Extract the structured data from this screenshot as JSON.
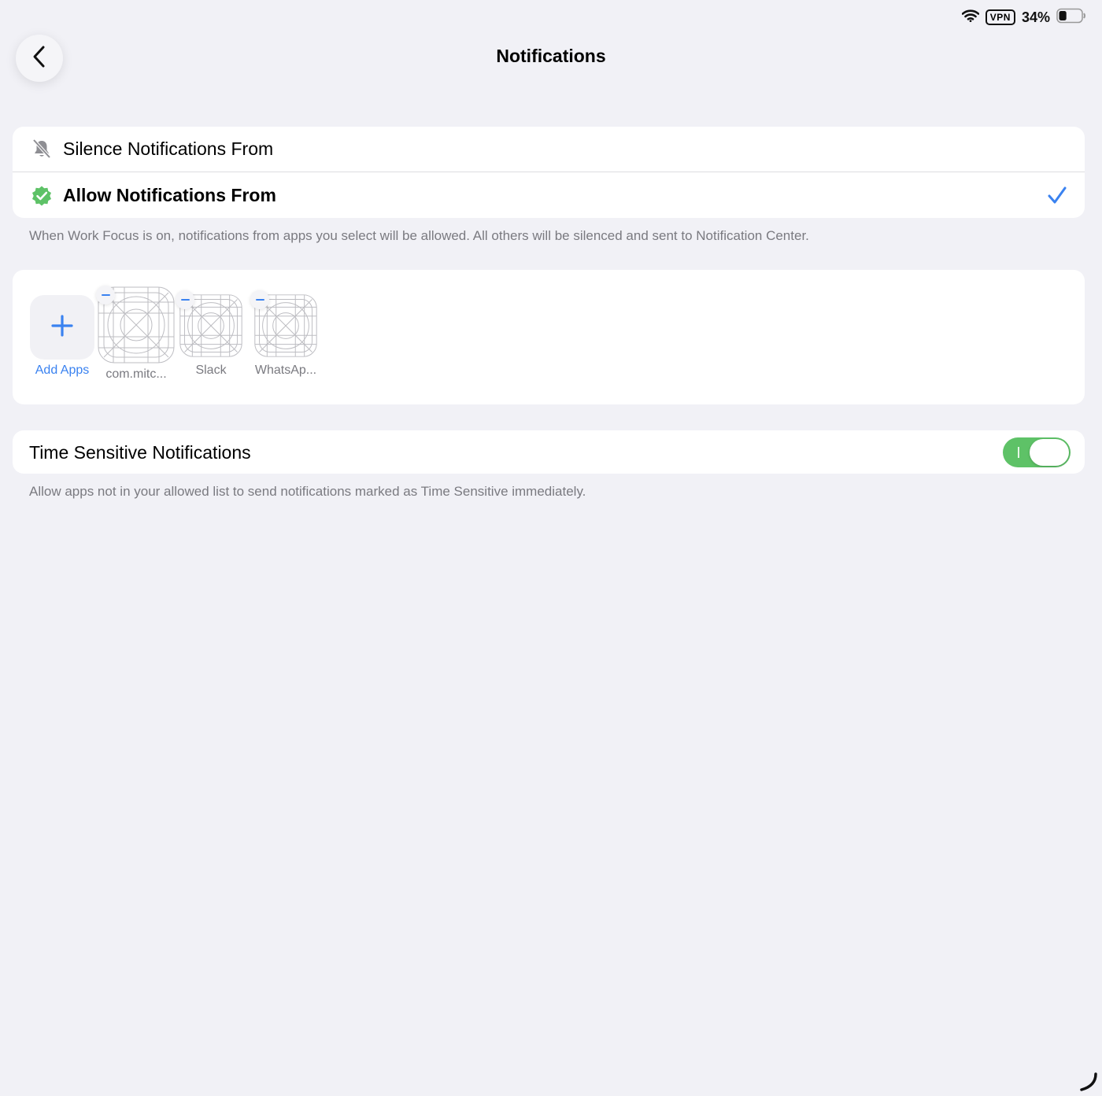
{
  "status_bar": {
    "wifi_icon": "wifi-icon",
    "vpn_label": "VPN",
    "battery_percent": "34%",
    "battery_level": 0.34
  },
  "header": {
    "back_icon": "chevron-left-icon",
    "title": "Notifications"
  },
  "mode_options": {
    "silence": {
      "icon": "bell-slash-icon",
      "label": "Silence Notifications From",
      "selected": false
    },
    "allow": {
      "icon": "checkmark-seal-icon",
      "label": "Allow Notifications From",
      "selected": true
    },
    "footnote": "When Work Focus is on, notifications from apps you select will be allowed. All others will be silenced and sent to Notification Center."
  },
  "apps": {
    "add_label": "Add Apps",
    "items": [
      {
        "label": "com.mitc..."
      },
      {
        "label": "Slack"
      },
      {
        "label": "WhatsAp..."
      }
    ]
  },
  "time_sensitive": {
    "label": "Time Sensitive Notifications",
    "enabled": true,
    "footnote": "Allow apps not in your allowed list to send notifications marked as Time Sensitive immediately."
  },
  "colors": {
    "accent": "#3a82f0",
    "toggle_on": "#5ec267",
    "background": "#f1f1f6"
  }
}
